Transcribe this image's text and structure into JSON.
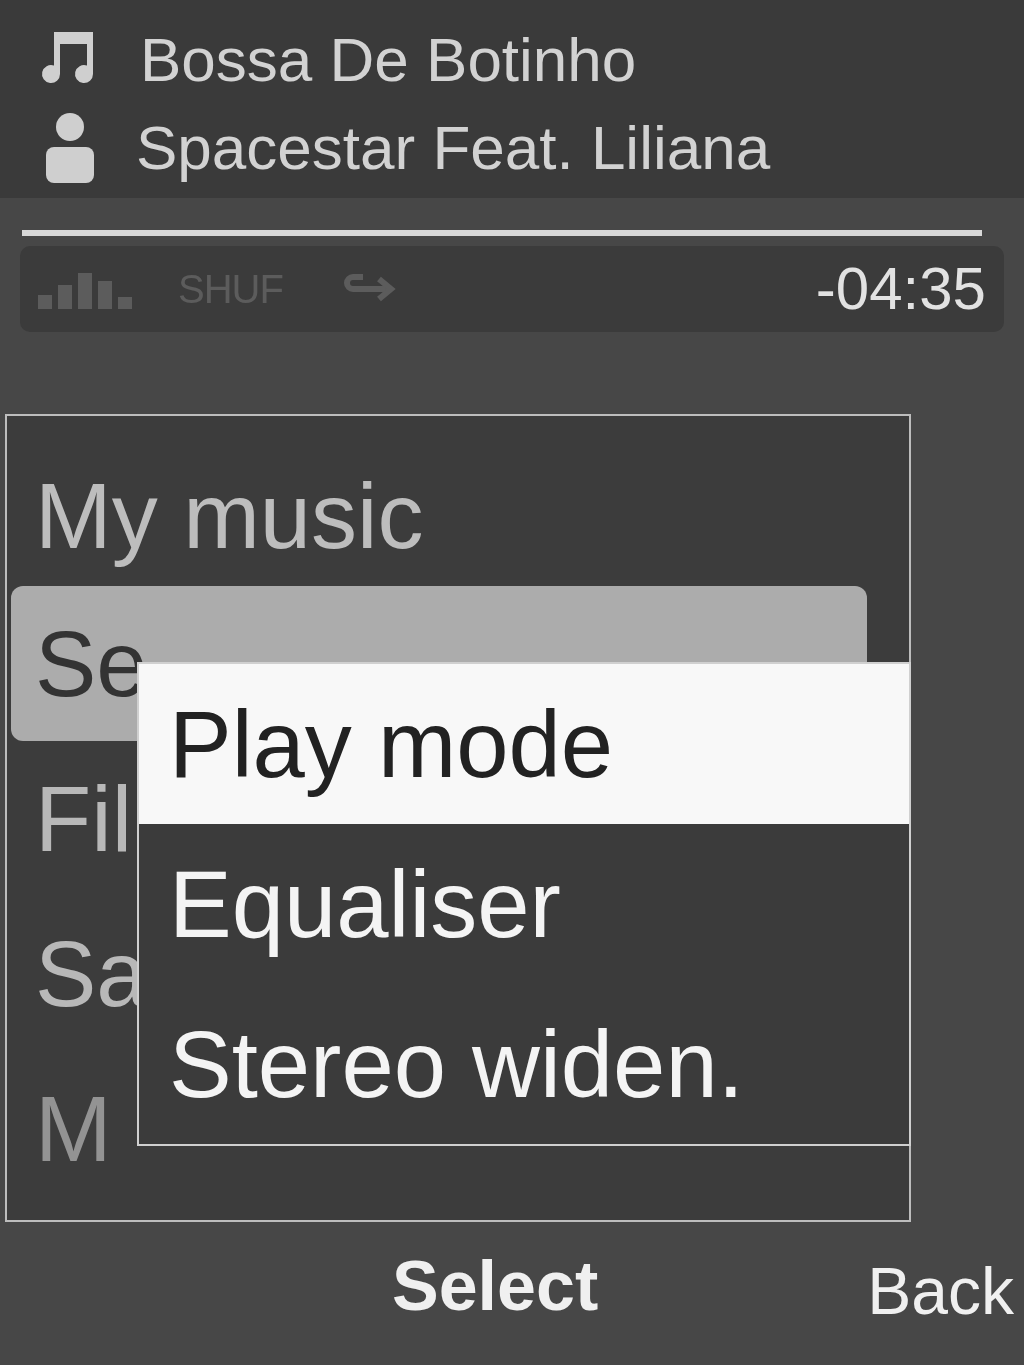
{
  "now_playing": {
    "track": "Bossa De Botinho",
    "artist": "Spacestar Feat. Liliana",
    "remaining": "-04:35",
    "shuffle": {
      "label": "SHUF",
      "on": false
    },
    "repeat": {
      "on": false
    }
  },
  "menu": {
    "title": "My music",
    "items": [
      {
        "label": "Se",
        "selected": true
      },
      {
        "label": "Fil",
        "selected": false
      },
      {
        "label": "Sa",
        "selected": false
      },
      {
        "label": "M",
        "selected": false
      }
    ]
  },
  "popup": {
    "items": [
      {
        "label": "Play mode",
        "selected": true
      },
      {
        "label": "Equaliser",
        "selected": false
      },
      {
        "label": "Stereo widen.",
        "selected": false
      }
    ]
  },
  "softkeys": {
    "middle": "Select",
    "right": "Back"
  }
}
